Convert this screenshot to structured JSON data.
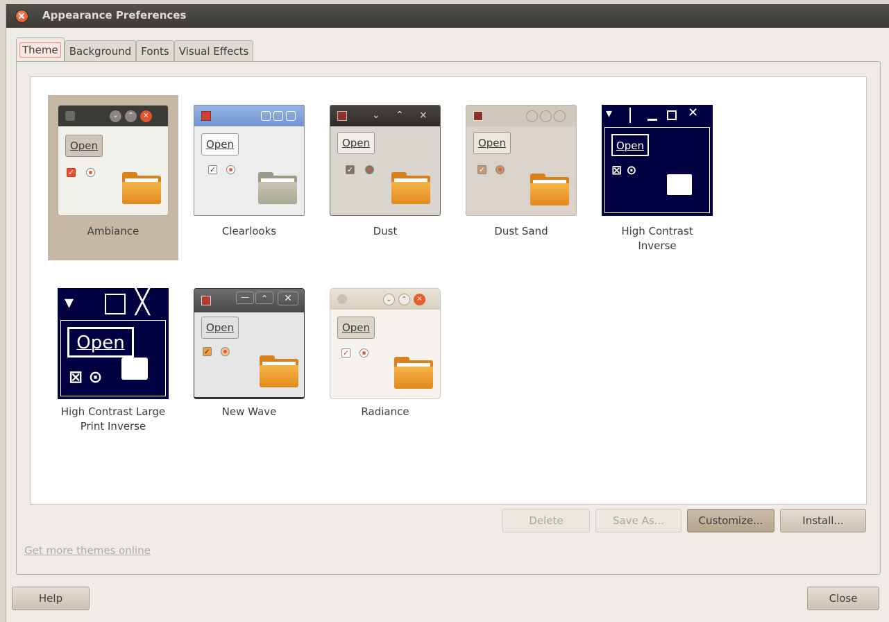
{
  "window": {
    "title": "Appearance Preferences"
  },
  "tabs": [
    {
      "label": "Theme"
    },
    {
      "label": "Background"
    },
    {
      "label": "Fonts"
    },
    {
      "label": "Visual Effects"
    }
  ],
  "themes": [
    {
      "name": "Ambiance",
      "selected": true
    },
    {
      "name": "Clearlooks",
      "selected": false
    },
    {
      "name": "Dust",
      "selected": false
    },
    {
      "name": "Dust Sand",
      "selected": false
    },
    {
      "name": "High Contrast Inverse",
      "selected": false
    },
    {
      "name": "High Contrast Large Print Inverse",
      "selected": false
    },
    {
      "name": "New Wave",
      "selected": false
    },
    {
      "name": "Radiance",
      "selected": false
    }
  ],
  "preview": {
    "open_label": "Open"
  },
  "actions": {
    "delete": "Delete",
    "save_as": "Save As...",
    "customize": "Customize...",
    "install": "Install..."
  },
  "get_more_link": "Get more themes online",
  "footer": {
    "help": "Help",
    "close": "Close"
  },
  "colors": {
    "accent": "#f08c72",
    "selection": "#c7b8a3",
    "title_bar": "#3c3b37"
  }
}
